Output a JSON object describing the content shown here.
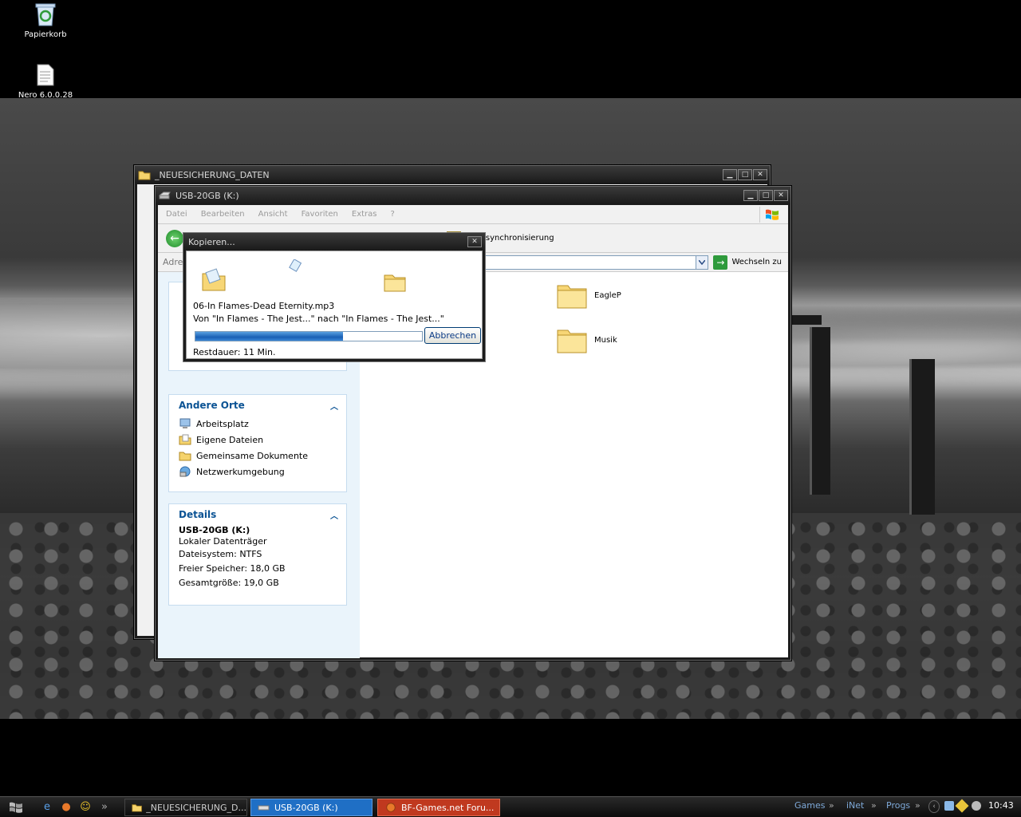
{
  "desktop": {
    "icons": [
      {
        "label": "Papierkorb",
        "icon": "recycle-bin-icon"
      },
      {
        "label": "Nero 6.0.0.28",
        "icon": "document-icon"
      }
    ]
  },
  "back_window": {
    "title": "_NEUESICHERUNG_DATEN"
  },
  "main_window": {
    "title": "USB-20GB (K:)",
    "menu": [
      "Datei",
      "Bearbeiten",
      "Ansicht",
      "Favoriten",
      "Extras",
      "?"
    ],
    "toolbar_text": "rdnersynchronisierung",
    "address_label": "Adre",
    "go_label": "Wechseln zu",
    "other_places": {
      "heading": "Andere Orte",
      "items": [
        "Arbeitsplatz",
        "Eigene Dateien",
        "Gemeinsame Dokumente",
        "Netzwerkumgebung"
      ]
    },
    "details": {
      "heading": "Details",
      "name": "USB-20GB (K:)",
      "type": "Lokaler Datenträger",
      "filesystem": "Dateisystem: NTFS",
      "free": "Freier Speicher: 18,0 GB",
      "total": "Gesamtgröße: 19,0 GB"
    },
    "folders": [
      "EagleP",
      "Musik"
    ]
  },
  "copy_dialog": {
    "title": "Kopieren...",
    "file": "06-In Flames-Dead Eternity.mp3",
    "from_to": "Von \"In Flames - The Jest...\" nach \"In Flames - The Jest...\"",
    "progress_fraction": 0.65,
    "remaining": "Restdauer: 11 Min.",
    "cancel_label": "Abbrechen"
  },
  "taskbar": {
    "buttons": [
      "_NEUESICHERUNG_D...",
      "USB-20GB (K:)",
      "BF-Games.net Foru..."
    ],
    "toolbars": [
      "Games",
      "iNet",
      "Progs"
    ],
    "chevron": "»",
    "clock": "10:43"
  },
  "colors": {
    "accent_blue": "#0b5394",
    "active_task": "#1f6fc5",
    "firefox_task": "#c0391f"
  }
}
